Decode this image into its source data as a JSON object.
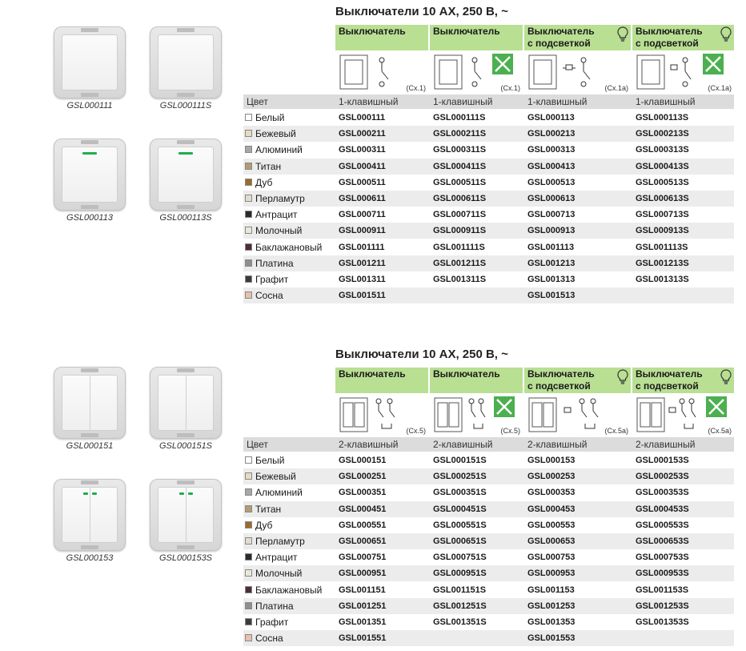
{
  "colors": {
    "header_green": "#b9df93",
    "led_green": "#1fae4c",
    "row_shade": "#ececec",
    "header_gray": "#dcdcdc",
    "swatches": {
      "white": "#ffffff",
      "beige": "#e6dcbe",
      "aluminum": "#a7a7a7",
      "titan": "#b49b73",
      "oak": "#9c6a2a",
      "pearl": "#e2ddd0",
      "anthracite": "#2a2a2a",
      "milk": "#ece8d6",
      "eggplant": "#4b2c3c",
      "platinum": "#8f8f8f",
      "graphite": "#3b3b3b",
      "pine": "#e9bfae"
    }
  },
  "sections": [
    {
      "title": "Выключатели 10 АХ, 250 В, ~",
      "photo_captions": [
        "GSL000111",
        "GSL000111S",
        "GSL000113",
        "GSL000113S"
      ],
      "columns": [
        {
          "line1": "Выключатель",
          "line2": "",
          "bulb": false,
          "scheme": "(Сх.1)",
          "tool_icon": false
        },
        {
          "line1": "Выключатель",
          "line2": "",
          "bulb": false,
          "scheme": "(Сх.1)",
          "tool_icon": true
        },
        {
          "line1": "Выключатель",
          "line2": "с подсветкой",
          "bulb": true,
          "scheme": "(Сх.1а)",
          "tool_icon": false
        },
        {
          "line1": "Выключатель",
          "line2": "с подсветкой",
          "bulb": true,
          "scheme": "(Сх.1а)",
          "tool_icon": true
        }
      ],
      "header_row": {
        "color_label": "Цвет",
        "types": [
          "1-клавишный",
          "1-клавишный",
          "1-клавишный",
          "1-клавишный"
        ]
      },
      "rows": [
        {
          "color": "Белый",
          "swatch": "white",
          "codes": [
            "GSL000111",
            "GSL000111S",
            "GSL000113",
            "GSL000113S"
          ]
        },
        {
          "color": "Бежевый",
          "swatch": "beige",
          "codes": [
            "GSL000211",
            "GSL000211S",
            "GSL000213",
            "GSL000213S"
          ]
        },
        {
          "color": "Алюминий",
          "swatch": "aluminum",
          "codes": [
            "GSL000311",
            "GSL000311S",
            "GSL000313",
            "GSL000313S"
          ]
        },
        {
          "color": "Титан",
          "swatch": "titan",
          "codes": [
            "GSL000411",
            "GSL000411S",
            "GSL000413",
            "GSL000413S"
          ]
        },
        {
          "color": "Дуб",
          "swatch": "oak",
          "codes": [
            "GSL000511",
            "GSL000511S",
            "GSL000513",
            "GSL000513S"
          ]
        },
        {
          "color": "Перламутр",
          "swatch": "pearl",
          "codes": [
            "GSL000611",
            "GSL000611S",
            "GSL000613",
            "GSL000613S"
          ]
        },
        {
          "color": "Антрацит",
          "swatch": "anthracite",
          "codes": [
            "GSL000711",
            "GSL000711S",
            "GSL000713",
            "GSL000713S"
          ]
        },
        {
          "color": "Молочный",
          "swatch": "milk",
          "codes": [
            "GSL000911",
            "GSL000911S",
            "GSL000913",
            "GSL000913S"
          ]
        },
        {
          "color": "Баклажановый",
          "swatch": "eggplant",
          "codes": [
            "GSL001111",
            "GSL001111S",
            "GSL001113",
            "GSL001113S"
          ]
        },
        {
          "color": "Платина",
          "swatch": "platinum",
          "codes": [
            "GSL001211",
            "GSL001211S",
            "GSL001213",
            "GSL001213S"
          ]
        },
        {
          "color": "Графит",
          "swatch": "graphite",
          "codes": [
            "GSL001311",
            "GSL001311S",
            "GSL001313",
            "GSL001313S"
          ]
        },
        {
          "color": "Сосна",
          "swatch": "pine",
          "codes": [
            "GSL001511",
            "",
            "GSL001513",
            ""
          ]
        }
      ]
    },
    {
      "title": "Выключатели 10 АХ, 250 В, ~",
      "photo_captions": [
        "GSL000151",
        "GSL000151S",
        "GSL000153",
        "GSL000153S"
      ],
      "columns": [
        {
          "line1": "Выключатель",
          "line2": "",
          "bulb": false,
          "scheme": "(Сх.5)",
          "tool_icon": false
        },
        {
          "line1": "Выключатель",
          "line2": "",
          "bulb": false,
          "scheme": "(Сх.5)",
          "tool_icon": true
        },
        {
          "line1": "Выключатель",
          "line2": "с подсветкой",
          "bulb": true,
          "scheme": "(Сх.5а)",
          "tool_icon": false
        },
        {
          "line1": "Выключатель",
          "line2": "с подсветкой",
          "bulb": true,
          "scheme": "(Сх.5а)",
          "tool_icon": true
        }
      ],
      "header_row": {
        "color_label": "Цвет",
        "types": [
          "2-клавишный",
          "2-клавишный",
          "2-клавишный",
          "2-клавишный"
        ]
      },
      "rows": [
        {
          "color": "Белый",
          "swatch": "white",
          "codes": [
            "GSL000151",
            "GSL000151S",
            "GSL000153",
            "GSL000153S"
          ]
        },
        {
          "color": "Бежевый",
          "swatch": "beige",
          "codes": [
            "GSL000251",
            "GSL000251S",
            "GSL000253",
            "GSL000253S"
          ]
        },
        {
          "color": "Алюминий",
          "swatch": "aluminum",
          "codes": [
            "GSL000351",
            "GSL000351S",
            "GSL000353",
            "GSL000353S"
          ]
        },
        {
          "color": "Титан",
          "swatch": "titan",
          "codes": [
            "GSL000451",
            "GSL000451S",
            "GSL000453",
            "GSL000453S"
          ]
        },
        {
          "color": "Дуб",
          "swatch": "oak",
          "codes": [
            "GSL000551",
            "GSL000551S",
            "GSL000553",
            "GSL000553S"
          ]
        },
        {
          "color": "Перламутр",
          "swatch": "pearl",
          "codes": [
            "GSL000651",
            "GSL000651S",
            "GSL000653",
            "GSL000653S"
          ]
        },
        {
          "color": "Антрацит",
          "swatch": "anthracite",
          "codes": [
            "GSL000751",
            "GSL000751S",
            "GSL000753",
            "GSL000753S"
          ]
        },
        {
          "color": "Молочный",
          "swatch": "milk",
          "codes": [
            "GSL000951",
            "GSL000951S",
            "GSL000953",
            "GSL000953S"
          ]
        },
        {
          "color": "Баклажановый",
          "swatch": "eggplant",
          "codes": [
            "GSL001151",
            "GSL001151S",
            "GSL001153",
            "GSL001153S"
          ]
        },
        {
          "color": "Платина",
          "swatch": "platinum",
          "codes": [
            "GSL001251",
            "GSL001251S",
            "GSL001253",
            "GSL001253S"
          ]
        },
        {
          "color": "Графит",
          "swatch": "graphite",
          "codes": [
            "GSL001351",
            "GSL001351S",
            "GSL001353",
            "GSL001353S"
          ]
        },
        {
          "color": "Сосна",
          "swatch": "pine",
          "codes": [
            "GSL001551",
            "",
            "GSL001553",
            ""
          ]
        }
      ]
    }
  ]
}
